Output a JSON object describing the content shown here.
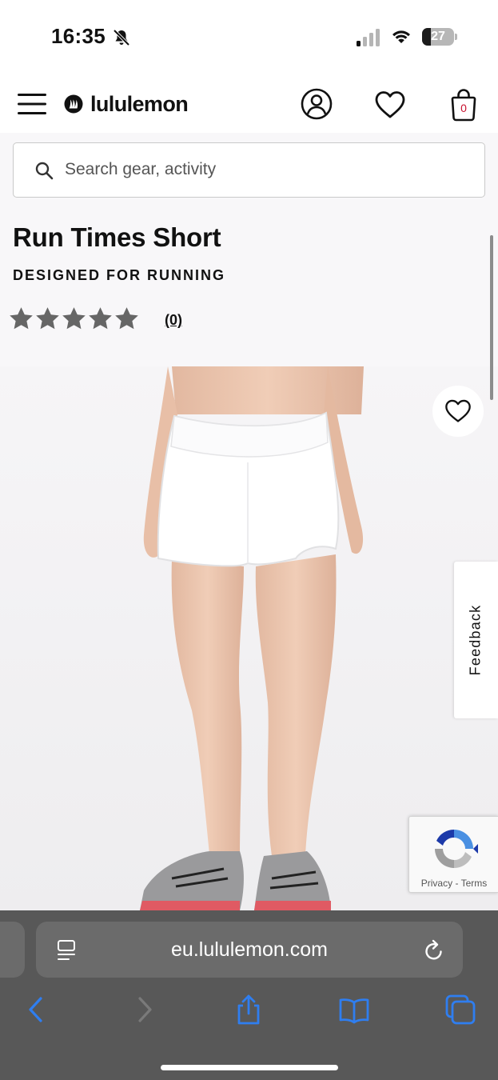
{
  "status_bar": {
    "time": "16:35",
    "battery_level": "27",
    "battery_fraction": 0.27,
    "icons": [
      "bell-slash-icon",
      "cellular-signal-icon",
      "wifi-icon",
      "battery-icon"
    ]
  },
  "header": {
    "logo_text": "lululemon",
    "bag_count": "0",
    "icons": [
      "menu-icon",
      "lululemon-logo-mark",
      "account-icon",
      "heart-icon",
      "shopping-bag-icon"
    ]
  },
  "search": {
    "placeholder": "Search gear, activity",
    "value": ""
  },
  "product": {
    "title": "Run Times Short",
    "tagline": "DESIGNED FOR RUNNING",
    "rating_stars": 5,
    "review_count": "(0)",
    "colors": {
      "star": "#666666",
      "accent": "#c8102e"
    }
  },
  "feedback": {
    "label": "Feedback"
  },
  "recaptcha": {
    "privacy": "Privacy",
    "separator": "-",
    "terms": "Terms"
  },
  "browser": {
    "url": "eu.lululemon.com",
    "toolbar_icons": [
      "back-icon",
      "forward-icon",
      "share-icon",
      "bookmarks-icon",
      "tabs-icon"
    ]
  }
}
